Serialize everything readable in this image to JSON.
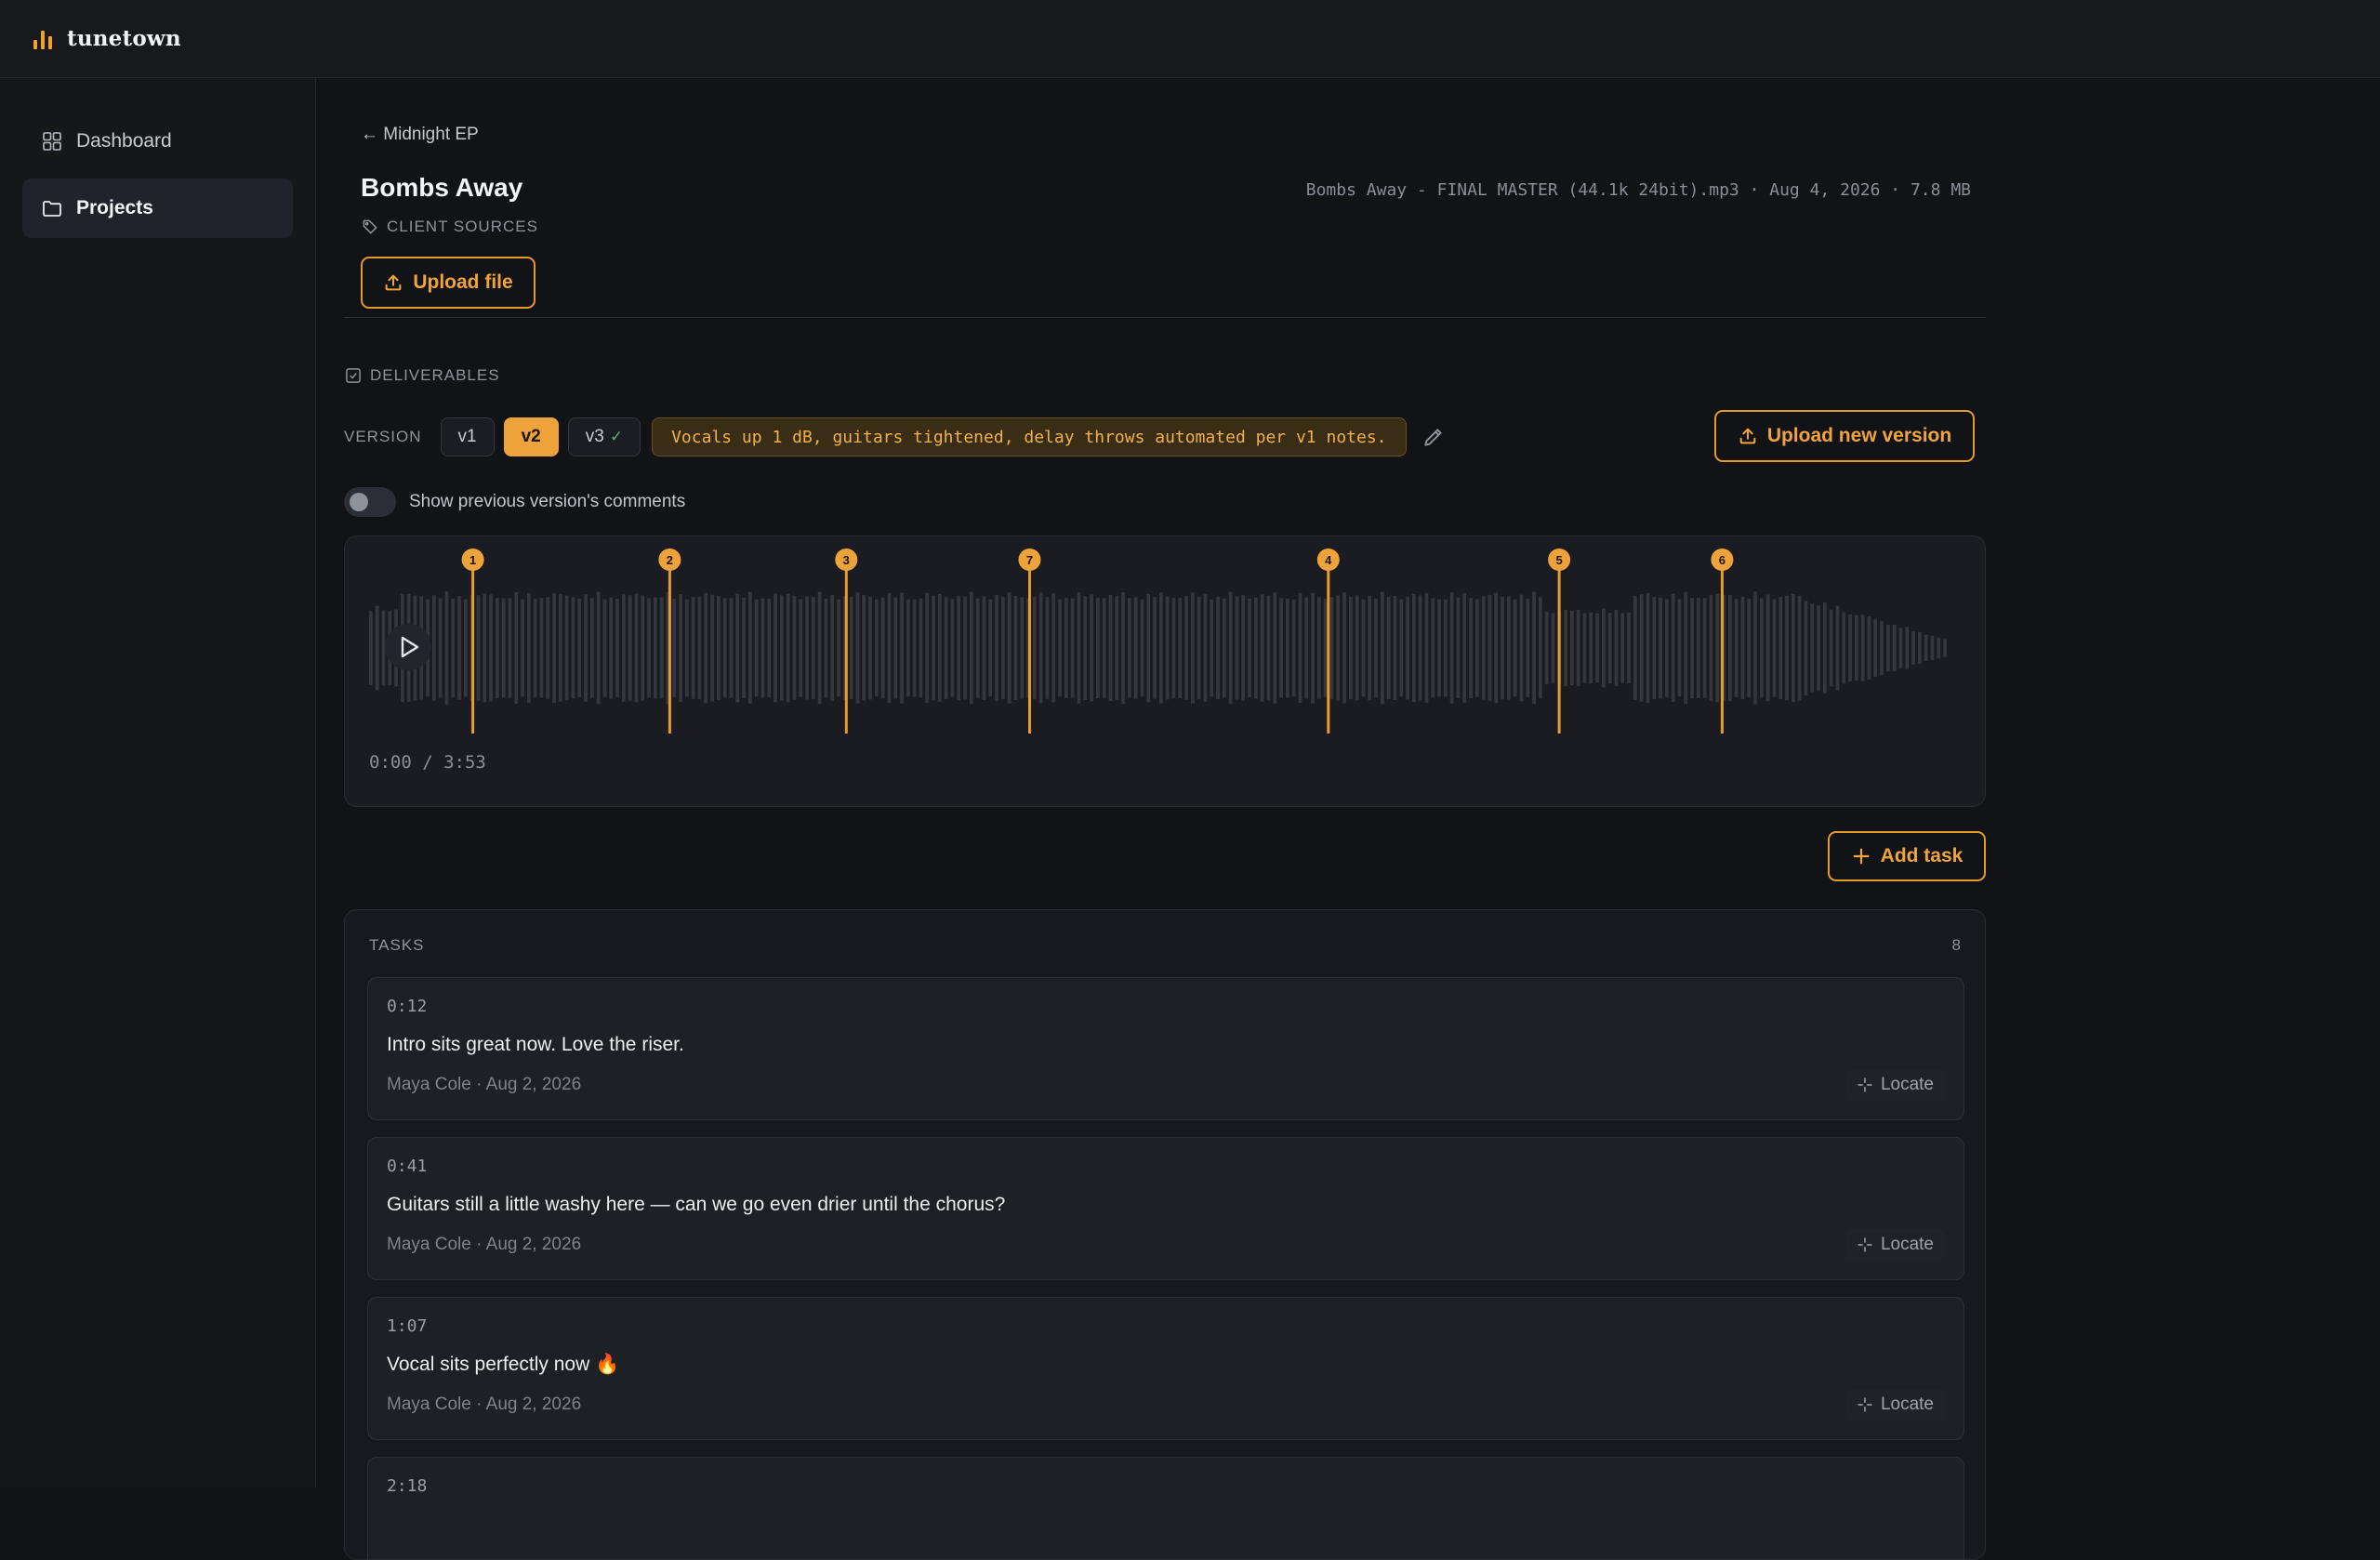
{
  "app": {
    "name": "tunetown",
    "accent": "#f0a22e"
  },
  "sidebar": {
    "items": [
      {
        "label": "Dashboard",
        "icon": "grid-icon",
        "active": false
      },
      {
        "label": "Projects",
        "icon": "folder-icon",
        "active": true
      }
    ]
  },
  "header": {
    "back_label": "← Midnight EP",
    "title": "Bombs Away",
    "file_meta": "Bombs Away - FINAL MASTER (44.1k 24bit).mp3 · Aug 4, 2026 · 7.8 MB",
    "client_sources_label": "CLIENT SOURCES",
    "upload_file_label": "Upload file"
  },
  "deliverables": {
    "label": "DELIVERABLES",
    "version_label": "VERSION",
    "versions": [
      {
        "label": "v1",
        "active": false,
        "approved": false
      },
      {
        "label": "v2",
        "active": true,
        "approved": false
      },
      {
        "label": "v3",
        "active": false,
        "approved": true
      }
    ],
    "version_note": "Vocals up 1 dB, guitars tightened, delay throws automated per v1 notes.",
    "upload_new_version_label": "Upload new version",
    "toggle_label": "Show previous version's comments",
    "toggle_on": false
  },
  "player": {
    "time_readout": "0:00 / 3:53",
    "markers": [
      {
        "label": "1",
        "time": "0:12"
      },
      {
        "label": "2",
        "time": "0:41"
      },
      {
        "label": "3",
        "time": "1:07"
      },
      {
        "label": "7",
        "time": "1:34"
      },
      {
        "label": "4",
        "time": "2:18"
      },
      {
        "label": "5",
        "time": "2:52"
      },
      {
        "label": "6",
        "time": "3:16"
      }
    ]
  },
  "add_task_label": "Add task",
  "tasks": {
    "label": "TASKS",
    "count": "8",
    "locate_label": "Locate",
    "items": [
      {
        "time": "0:12",
        "message": "Intro sits great now. Love the riser.",
        "byline": "Maya Cole · Aug 2, 2026"
      },
      {
        "time": "0:41",
        "message": "Guitars still a little washy here — can we go even drier until the chorus?",
        "byline": "Maya Cole · Aug 2, 2026"
      },
      {
        "time": "1:07",
        "message": "Vocal sits perfectly now 🔥",
        "byline": "Maya Cole · Aug 2, 2026"
      },
      {
        "time": "2:18",
        "message": "",
        "byline": ""
      }
    ]
  }
}
